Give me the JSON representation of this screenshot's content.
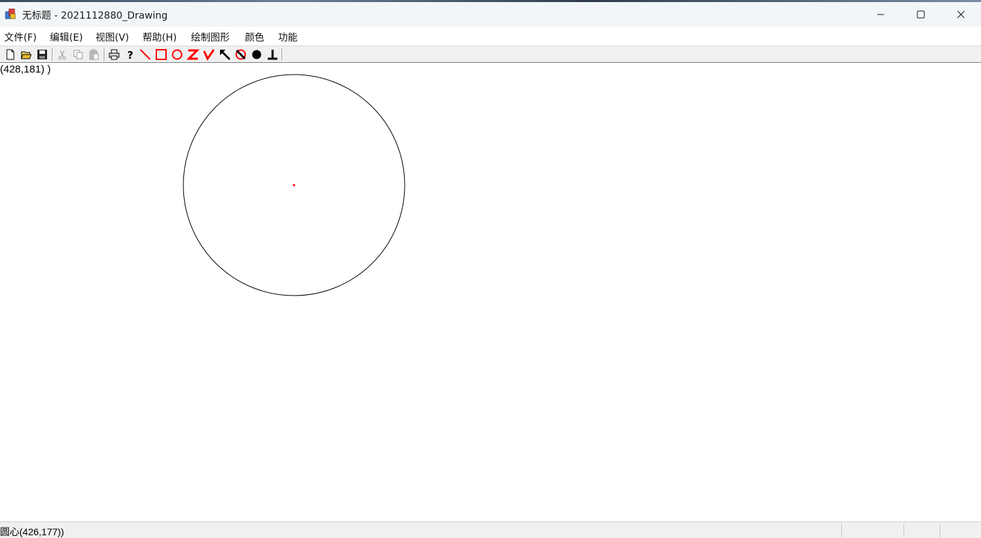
{
  "window": {
    "title": "无标题 - 2021112880_Drawing"
  },
  "menu": {
    "items": [
      "文件(F)",
      "编辑(E)",
      "视图(V)",
      "帮助(H)",
      "绘制图形",
      "颜色",
      "功能"
    ]
  },
  "toolbar": {
    "buttons": [
      {
        "name": "new-icon"
      },
      {
        "name": "open-icon"
      },
      {
        "name": "save-icon"
      },
      {
        "name": "cut-icon"
      },
      {
        "name": "copy-icon"
      },
      {
        "name": "paste-icon"
      },
      {
        "name": "print-icon"
      },
      {
        "name": "help-icon"
      },
      {
        "name": "line-tool-icon",
        "color": "#ff0000"
      },
      {
        "name": "rectangle-tool-icon",
        "color": "#ff0000"
      },
      {
        "name": "circle-tool-icon",
        "color": "#ff0000"
      },
      {
        "name": "zigzag-tool-icon",
        "color": "#ff0000"
      },
      {
        "name": "check-tool-icon",
        "color": "#ff0000"
      },
      {
        "name": "arrow-tool-icon",
        "color": "#000000"
      },
      {
        "name": "no-fill-tool-icon",
        "color": "#000000"
      },
      {
        "name": "filled-circle-tool-icon",
        "color": "#000000"
      },
      {
        "name": "perpendicular-tool-icon",
        "color": "#000000"
      }
    ]
  },
  "canvas": {
    "cursor_readout": "(428,181) )",
    "shape": {
      "type": "circle",
      "stroke": "#000000",
      "center_color": "#ff0000"
    }
  },
  "status": {
    "text": "圆心(426,177))"
  }
}
